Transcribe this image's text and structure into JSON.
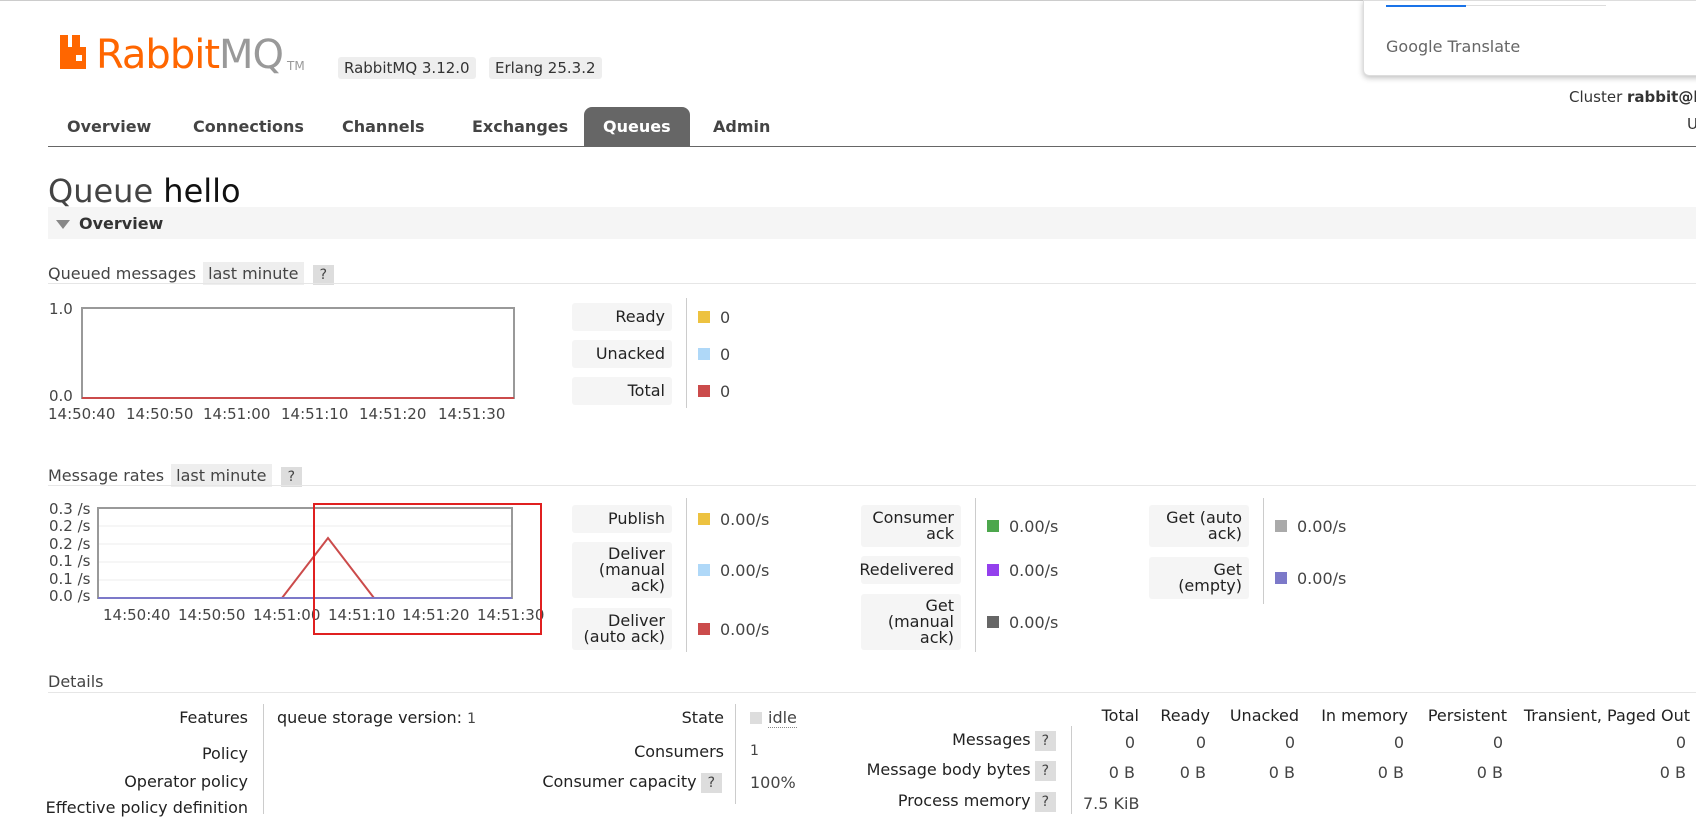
{
  "app": {
    "logo_main": "Rabbit",
    "logo_mq": "MQ",
    "logo_tm": "TM",
    "version": "RabbitMQ 3.12.0",
    "erlang": "Erlang 25.3.2",
    "brand_color": "#ff6600"
  },
  "nav": {
    "items": [
      "Overview",
      "Connections",
      "Channels",
      "Exchanges",
      "Queues",
      "Admin"
    ],
    "active": "Queues"
  },
  "cluster": {
    "label": "Cluster",
    "name": "rabbit@l",
    "user_fragment": "U"
  },
  "translate_popup": {
    "label": "Google Translate"
  },
  "page": {
    "prefix": "Queue",
    "queue_name": "hello"
  },
  "overview_section": {
    "title": "Overview"
  },
  "queued_messages": {
    "title": "Queued messages",
    "range": "last minute",
    "help": "?",
    "stats": [
      {
        "label": "Ready",
        "value": "0",
        "color": "#edc240"
      },
      {
        "label": "Unacked",
        "value": "0",
        "color": "#afd8f8"
      },
      {
        "label": "Total",
        "value": "0",
        "color": "#cb4b4b"
      }
    ]
  },
  "message_rates": {
    "title": "Message rates",
    "range": "last minute",
    "help": "?",
    "col1": [
      {
        "label": "Publish",
        "value": "0.00/s",
        "color": "#edc240"
      },
      {
        "label": "Deliver (manual ack)",
        "value": "0.00/s",
        "color": "#afd8f8"
      },
      {
        "label": "Deliver (auto ack)",
        "value": "0.00/s",
        "color": "#cb4b4b"
      }
    ],
    "col2": [
      {
        "label": "Consumer ack",
        "value": "0.00/s",
        "color": "#4da74d"
      },
      {
        "label": "Redelivered",
        "value": "0.00/s",
        "color": "#9440ed"
      },
      {
        "label": "Get (manual ack)",
        "value": "0.00/s",
        "color": "#666666"
      }
    ],
    "col3": [
      {
        "label": "Get (auto ack)",
        "value": "0.00/s",
        "color": "#aaaaaa"
      },
      {
        "label": "Get (empty)",
        "value": "0.00/s",
        "color": "#7c79c9"
      }
    ]
  },
  "chart_data": [
    {
      "type": "line",
      "title": "Queued messages",
      "x": [
        "14:50:40",
        "14:50:50",
        "14:51:00",
        "14:51:10",
        "14:51:20",
        "14:51:30"
      ],
      "yticks": [
        "1.0",
        "0.0"
      ],
      "ylim": [
        0,
        1
      ],
      "series": [
        {
          "name": "Ready",
          "color": "#edc240",
          "values": [
            0,
            0,
            0,
            0,
            0,
            0
          ]
        },
        {
          "name": "Unacked",
          "color": "#afd8f8",
          "values": [
            0,
            0,
            0,
            0,
            0,
            0
          ]
        },
        {
          "name": "Total",
          "color": "#cb4b4b",
          "values": [
            0,
            0,
            0,
            0,
            0,
            0
          ]
        }
      ]
    },
    {
      "type": "line",
      "title": "Message rates",
      "x": [
        "14:50:40",
        "14:50:50",
        "14:51:00",
        "14:51:10",
        "14:51:20",
        "14:51:30"
      ],
      "yticks": [
        "0.3 /s",
        "0.2 /s",
        "0.2 /s",
        "0.1 /s",
        "0.1 /s",
        "0.0 /s"
      ],
      "ylim": [
        0,
        0.3
      ],
      "series": [
        {
          "name": "Deliver (auto ack)",
          "color": "#cb4b4b",
          "values": [
            0,
            0,
            0,
            0,
            0,
            0.2,
            0,
            0,
            0,
            0
          ]
        },
        {
          "name": "Get (empty)",
          "color": "#7c79c9",
          "values": [
            0,
            0,
            0,
            0,
            0,
            0,
            0,
            0,
            0,
            0
          ]
        }
      ],
      "peak": {
        "series": "Deliver (auto ack)",
        "time_between": [
          "14:51:10",
          "14:51:20"
        ],
        "value": 0.2
      }
    }
  ],
  "details": {
    "title": "Details",
    "features_label": "Features",
    "features_key": "queue storage version:",
    "features_value": "1",
    "policy_label": "Policy",
    "operator_policy_label": "Operator policy",
    "effective_policy_label": "Effective policy definition",
    "state_label": "State",
    "state_value": "idle",
    "consumers_label": "Consumers",
    "consumers_value": "1",
    "consumer_capacity_label": "Consumer capacity",
    "consumer_capacity_value": "100%",
    "help": "?",
    "table": {
      "headers": [
        "Total",
        "Ready",
        "Unacked",
        "In memory",
        "Persistent",
        "Transient, Paged Out"
      ],
      "rows": [
        {
          "label": "Messages",
          "values": [
            "0",
            "0",
            "0",
            "0",
            "0",
            "0"
          ]
        },
        {
          "label": "Message body bytes",
          "values": [
            "0 B",
            "0 B",
            "0 B",
            "0 B",
            "0 B",
            "0 B"
          ]
        },
        {
          "label": "Process memory",
          "values": [
            "7.5 KiB"
          ]
        }
      ]
    }
  }
}
